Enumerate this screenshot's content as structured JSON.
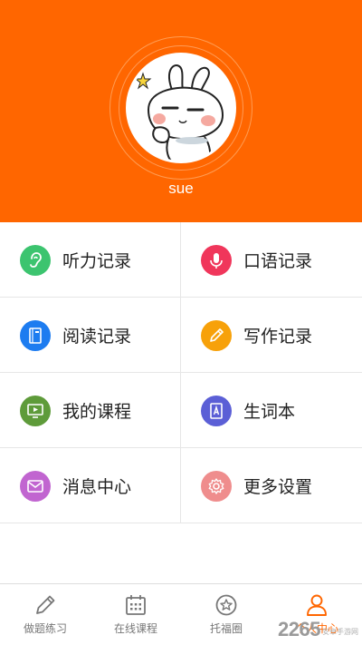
{
  "profile": {
    "username": "sue",
    "avatar": "cartoon-rabbit-avatar"
  },
  "menu": [
    {
      "label": "听力记录",
      "icon": "ear-icon",
      "color": "#3cc46f"
    },
    {
      "label": "口语记录",
      "icon": "microphone-icon",
      "color": "#f0365b"
    },
    {
      "label": "阅读记录",
      "icon": "book-icon",
      "color": "#1d7cf0"
    },
    {
      "label": "写作记录",
      "icon": "pencil-icon",
      "color": "#f7a10a"
    },
    {
      "label": "我的课程",
      "icon": "play-screen-icon",
      "color": "#5e9b3a"
    },
    {
      "label": "生词本",
      "icon": "vocabulary-book-icon",
      "color": "#5b5fd6"
    },
    {
      "label": "消息中心",
      "icon": "envelope-icon",
      "color": "#c165d0"
    },
    {
      "label": "更多设置",
      "icon": "gear-icon",
      "color": "#ef8d8d"
    }
  ],
  "tabbar": {
    "tabs": [
      {
        "label": "做题练习",
        "icon": "pencil-icon"
      },
      {
        "label": "在线课程",
        "icon": "calendar-icon"
      },
      {
        "label": "托福圈",
        "icon": "star-circle-icon"
      },
      {
        "label": "个人中心",
        "icon": "person-icon",
        "active": true
      }
    ]
  },
  "watermark": {
    "big": "2265",
    "small": "安卓手游网"
  },
  "colors": {
    "accent": "#ff6600",
    "divider": "#e6e6e6"
  }
}
